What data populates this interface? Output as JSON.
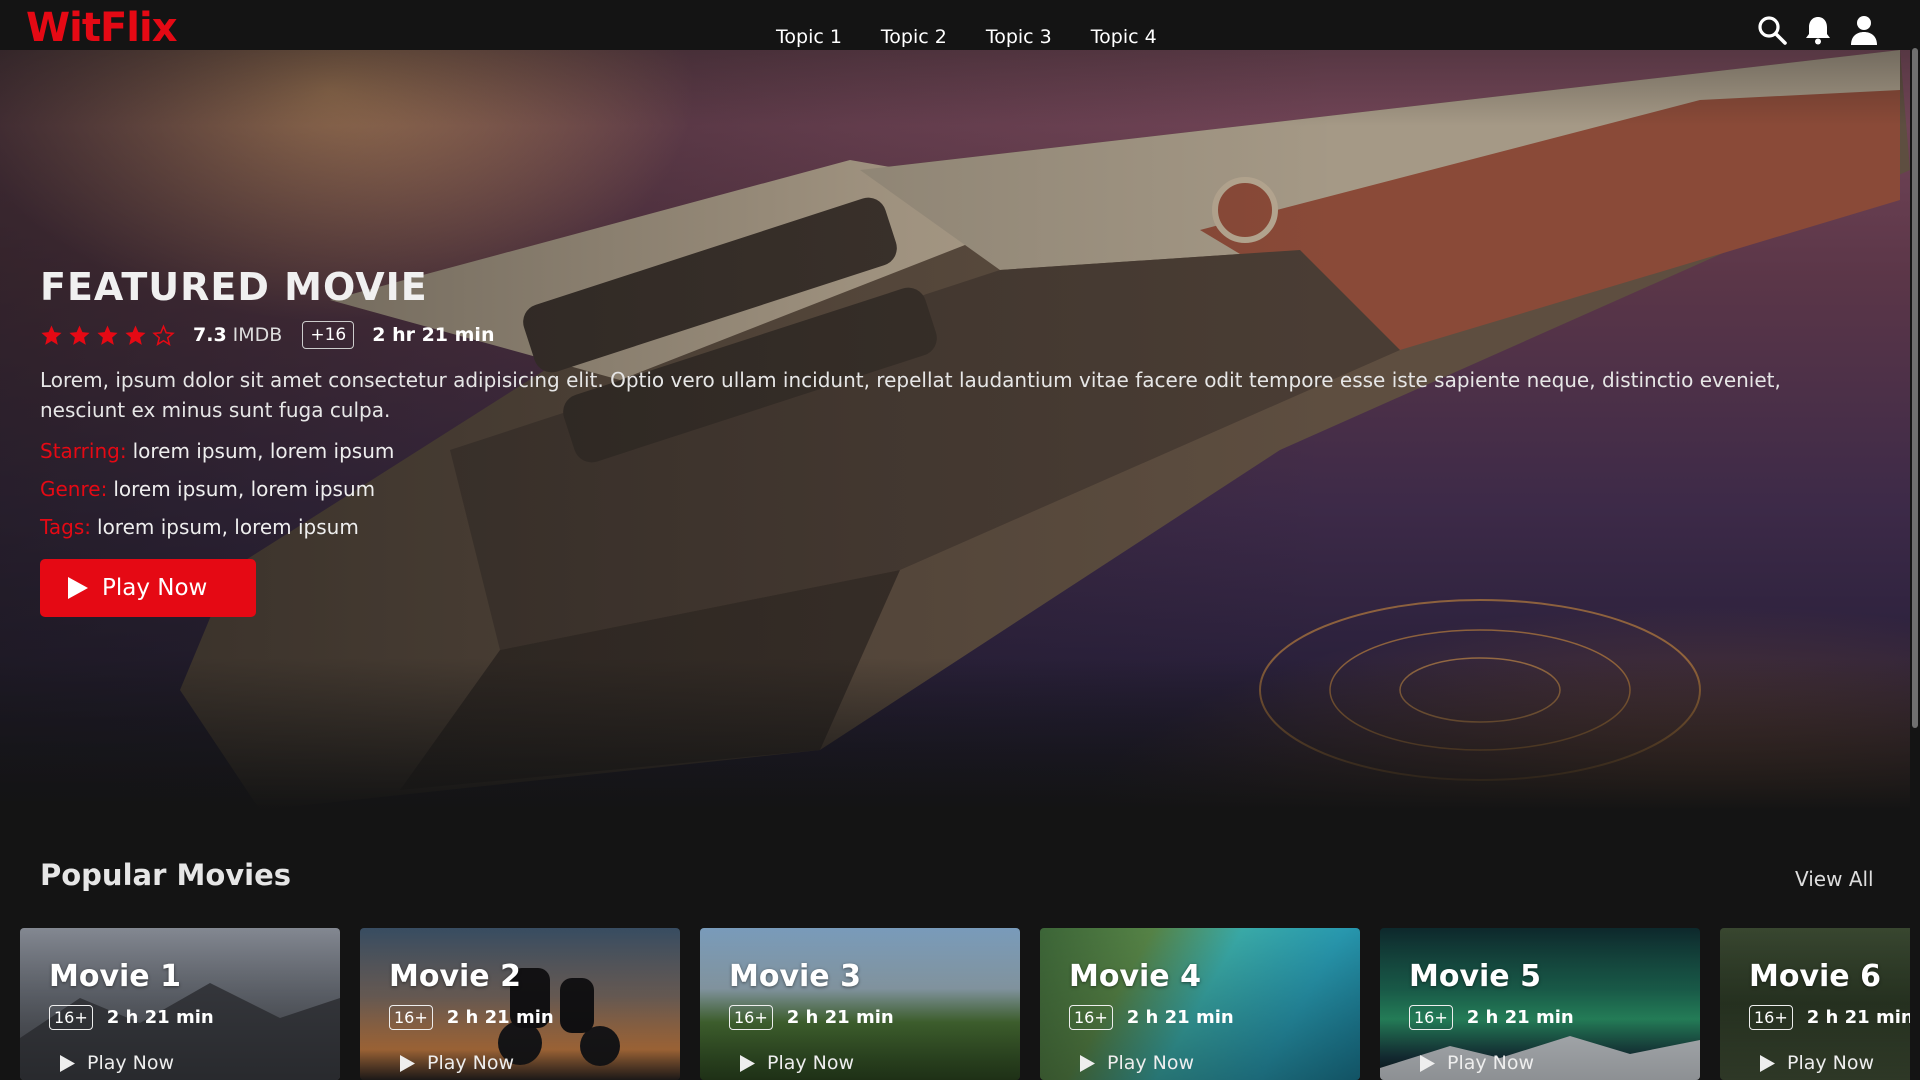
{
  "header": {
    "brand": "WitFlix",
    "nav": [
      "Topic 1",
      "Topic 2",
      "Topic 3",
      "Topic 4"
    ],
    "icons": [
      "search-icon",
      "bell-icon",
      "user-icon"
    ]
  },
  "hero": {
    "title": "FEATURED MOVIE",
    "rating": {
      "stars_filled": 4,
      "stars_total": 5,
      "value": "7.3",
      "source": "IMDB"
    },
    "age": "+16",
    "duration": "2 hr 21 min",
    "description": "Lorem, ipsum dolor sit amet consectetur adipisicing elit. Optio vero ullam incidunt, repellat laudantium vitae facere odit tempore esse iste sapiente neque, distinctio eveniet, nesciunt ex minus sunt fuga culpa.",
    "starring": {
      "label": "Starring:",
      "value": "lorem ipsum, lorem ipsum"
    },
    "genre": {
      "label": "Genre:",
      "value": "lorem ipsum, lorem ipsum"
    },
    "tags": {
      "label": "Tags:",
      "value": "lorem ipsum, lorem ipsum"
    },
    "play_label": "Play Now"
  },
  "popular": {
    "title": "Popular Movies",
    "view_all": "View All",
    "movies": [
      {
        "title": "Movie 1",
        "age": "16+",
        "duration": "2 h 21 min",
        "play": "Play Now"
      },
      {
        "title": "Movie 2",
        "age": "16+",
        "duration": "2 h 21 min",
        "play": "Play Now"
      },
      {
        "title": "Movie 3",
        "age": "16+",
        "duration": "2 h 21 min",
        "play": "Play Now"
      },
      {
        "title": "Movie 4",
        "age": "16+",
        "duration": "2 h 21 min",
        "play": "Play Now"
      },
      {
        "title": "Movie 5",
        "age": "16+",
        "duration": "2 h 21 min",
        "play": "Play Now"
      },
      {
        "title": "Movie 6",
        "age": "16+",
        "duration": "2 h 21 min",
        "play": "Play Now"
      }
    ]
  },
  "colors": {
    "brand": "#e50914",
    "background": "#141414"
  }
}
